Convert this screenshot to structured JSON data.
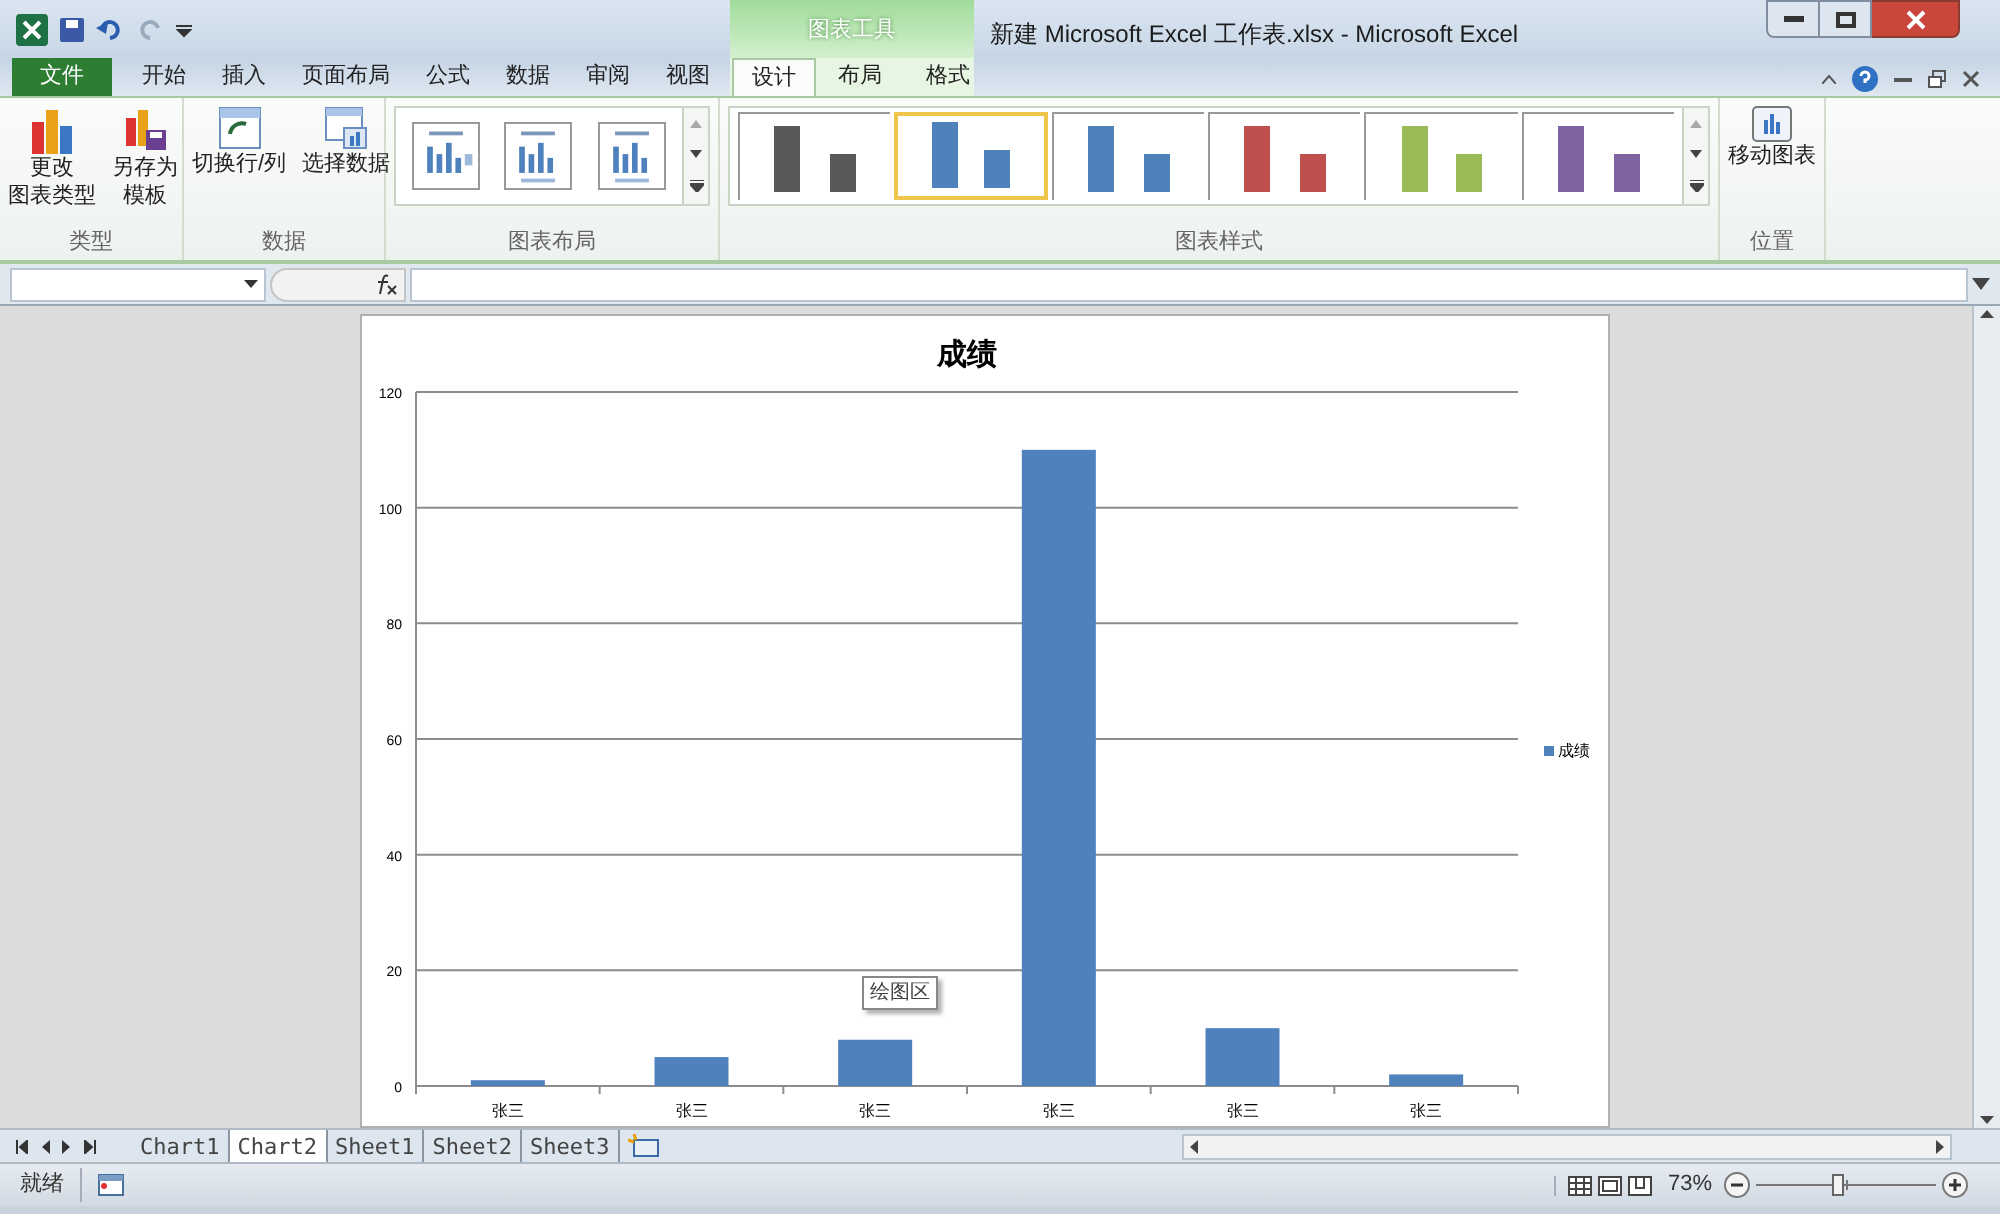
{
  "window": {
    "title": "新建 Microsoft Excel 工作表.xlsx - Microsoft Excel",
    "context_group": "图表工具"
  },
  "tabs": [
    {
      "label": "文件",
      "kind": "file",
      "selected": false
    },
    {
      "label": "开始",
      "kind": "normal",
      "selected": false
    },
    {
      "label": "插入",
      "kind": "normal",
      "selected": false
    },
    {
      "label": "页面布局",
      "kind": "normal",
      "selected": false
    },
    {
      "label": "公式",
      "kind": "normal",
      "selected": false
    },
    {
      "label": "数据",
      "kind": "normal",
      "selected": false
    },
    {
      "label": "审阅",
      "kind": "normal",
      "selected": false
    },
    {
      "label": "视图",
      "kind": "normal",
      "selected": false
    },
    {
      "label": "设计",
      "kind": "context",
      "selected": true
    },
    {
      "label": "布局",
      "kind": "context",
      "selected": false
    },
    {
      "label": "格式",
      "kind": "context",
      "selected": false
    }
  ],
  "ribbon": {
    "type_group": {
      "label": "类型",
      "buttons": [
        {
          "lines": [
            "更改",
            "图表类型"
          ]
        },
        {
          "lines": [
            "另存为",
            "模板"
          ]
        }
      ]
    },
    "data_group": {
      "label": "数据",
      "buttons": [
        {
          "lines": [
            "切换行/列"
          ]
        },
        {
          "lines": [
            "选择数据"
          ]
        }
      ]
    },
    "layout_group": {
      "label": "图表布局"
    },
    "style_group": {
      "label": "图表样式",
      "styles": [
        {
          "color": "#595959",
          "selected": false
        },
        {
          "color": "#4f81bd",
          "selected": true
        },
        {
          "color": "#4f81bd",
          "selected": false
        },
        {
          "color": "#c0504d",
          "selected": false
        },
        {
          "color": "#9bbb59",
          "selected": false
        },
        {
          "color": "#8064a2",
          "selected": false
        }
      ]
    },
    "location_group": {
      "label": "位置",
      "buttons": [
        {
          "lines": [
            "移动图表"
          ]
        }
      ]
    }
  },
  "chart": {
    "tooltip": "绘图区",
    "chart_data": {
      "type": "bar",
      "grid": true,
      "title": "成绩",
      "categories": [
        "张三",
        "张三",
        "张三",
        "张三",
        "张三",
        "张三"
      ],
      "series": [
        {
          "name": "成绩",
          "color": "#4f81bd",
          "values": [
            1,
            5,
            8,
            110,
            10,
            2
          ]
        }
      ],
      "ylim": [
        0,
        120
      ],
      "yticks": [
        0,
        20,
        40,
        60,
        80,
        100,
        120
      ]
    }
  },
  "sheet_tabs": [
    {
      "label": "Chart1",
      "selected": false
    },
    {
      "label": "Chart2",
      "selected": true
    },
    {
      "label": "Sheet1",
      "selected": false
    },
    {
      "label": "Sheet2",
      "selected": false
    },
    {
      "label": "Sheet3",
      "selected": false
    }
  ],
  "status_bar": {
    "status": "就绪",
    "zoom": "73%",
    "zoom_level": {
      "level": 0.45
    }
  }
}
